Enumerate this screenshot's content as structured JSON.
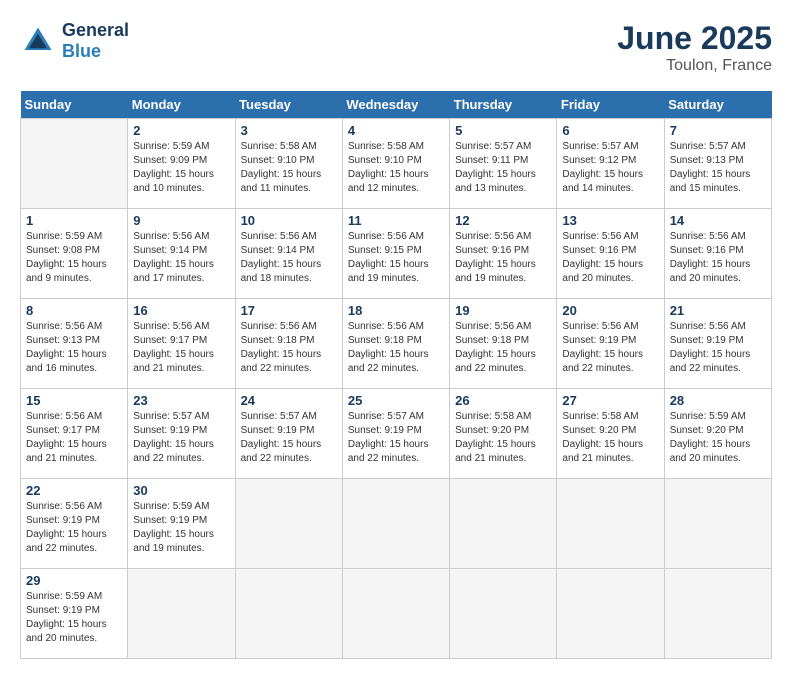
{
  "header": {
    "logo_text_general": "General",
    "logo_text_blue": "Blue",
    "month_year": "June 2025",
    "location": "Toulon, France"
  },
  "calendar": {
    "weekdays": [
      "Sunday",
      "Monday",
      "Tuesday",
      "Wednesday",
      "Thursday",
      "Friday",
      "Saturday"
    ],
    "weeks": [
      [
        null,
        {
          "day": "2",
          "sunrise": "Sunrise: 5:59 AM",
          "sunset": "Sunset: 9:09 PM",
          "daylight": "Daylight: 15 hours and 10 minutes."
        },
        {
          "day": "3",
          "sunrise": "Sunrise: 5:58 AM",
          "sunset": "Sunset: 9:10 PM",
          "daylight": "Daylight: 15 hours and 11 minutes."
        },
        {
          "day": "4",
          "sunrise": "Sunrise: 5:58 AM",
          "sunset": "Sunset: 9:10 PM",
          "daylight": "Daylight: 15 hours and 12 minutes."
        },
        {
          "day": "5",
          "sunrise": "Sunrise: 5:57 AM",
          "sunset": "Sunset: 9:11 PM",
          "daylight": "Daylight: 15 hours and 13 minutes."
        },
        {
          "day": "6",
          "sunrise": "Sunrise: 5:57 AM",
          "sunset": "Sunset: 9:12 PM",
          "daylight": "Daylight: 15 hours and 14 minutes."
        },
        {
          "day": "7",
          "sunrise": "Sunrise: 5:57 AM",
          "sunset": "Sunset: 9:13 PM",
          "daylight": "Daylight: 15 hours and 15 minutes."
        }
      ],
      [
        {
          "day": "1",
          "sunrise": "Sunrise: 5:59 AM",
          "sunset": "Sunset: 9:08 PM",
          "daylight": "Daylight: 15 hours and 9 minutes."
        },
        {
          "day": "9",
          "sunrise": "Sunrise: 5:56 AM",
          "sunset": "Sunset: 9:14 PM",
          "daylight": "Daylight: 15 hours and 17 minutes."
        },
        {
          "day": "10",
          "sunrise": "Sunrise: 5:56 AM",
          "sunset": "Sunset: 9:14 PM",
          "daylight": "Daylight: 15 hours and 18 minutes."
        },
        {
          "day": "11",
          "sunrise": "Sunrise: 5:56 AM",
          "sunset": "Sunset: 9:15 PM",
          "daylight": "Daylight: 15 hours and 19 minutes."
        },
        {
          "day": "12",
          "sunrise": "Sunrise: 5:56 AM",
          "sunset": "Sunset: 9:16 PM",
          "daylight": "Daylight: 15 hours and 19 minutes."
        },
        {
          "day": "13",
          "sunrise": "Sunrise: 5:56 AM",
          "sunset": "Sunset: 9:16 PM",
          "daylight": "Daylight: 15 hours and 20 minutes."
        },
        {
          "day": "14",
          "sunrise": "Sunrise: 5:56 AM",
          "sunset": "Sunset: 9:16 PM",
          "daylight": "Daylight: 15 hours and 20 minutes."
        }
      ],
      [
        {
          "day": "8",
          "sunrise": "Sunrise: 5:56 AM",
          "sunset": "Sunset: 9:13 PM",
          "daylight": "Daylight: 15 hours and 16 minutes."
        },
        {
          "day": "16",
          "sunrise": "Sunrise: 5:56 AM",
          "sunset": "Sunset: 9:17 PM",
          "daylight": "Daylight: 15 hours and 21 minutes."
        },
        {
          "day": "17",
          "sunrise": "Sunrise: 5:56 AM",
          "sunset": "Sunset: 9:18 PM",
          "daylight": "Daylight: 15 hours and 22 minutes."
        },
        {
          "day": "18",
          "sunrise": "Sunrise: 5:56 AM",
          "sunset": "Sunset: 9:18 PM",
          "daylight": "Daylight: 15 hours and 22 minutes."
        },
        {
          "day": "19",
          "sunrise": "Sunrise: 5:56 AM",
          "sunset": "Sunset: 9:18 PM",
          "daylight": "Daylight: 15 hours and 22 minutes."
        },
        {
          "day": "20",
          "sunrise": "Sunrise: 5:56 AM",
          "sunset": "Sunset: 9:19 PM",
          "daylight": "Daylight: 15 hours and 22 minutes."
        },
        {
          "day": "21",
          "sunrise": "Sunrise: 5:56 AM",
          "sunset": "Sunset: 9:19 PM",
          "daylight": "Daylight: 15 hours and 22 minutes."
        }
      ],
      [
        {
          "day": "15",
          "sunrise": "Sunrise: 5:56 AM",
          "sunset": "Sunset: 9:17 PM",
          "daylight": "Daylight: 15 hours and 21 minutes."
        },
        {
          "day": "23",
          "sunrise": "Sunrise: 5:57 AM",
          "sunset": "Sunset: 9:19 PM",
          "daylight": "Daylight: 15 hours and 22 minutes."
        },
        {
          "day": "24",
          "sunrise": "Sunrise: 5:57 AM",
          "sunset": "Sunset: 9:19 PM",
          "daylight": "Daylight: 15 hours and 22 minutes."
        },
        {
          "day": "25",
          "sunrise": "Sunrise: 5:57 AM",
          "sunset": "Sunset: 9:19 PM",
          "daylight": "Daylight: 15 hours and 22 minutes."
        },
        {
          "day": "26",
          "sunrise": "Sunrise: 5:58 AM",
          "sunset": "Sunset: 9:20 PM",
          "daylight": "Daylight: 15 hours and 21 minutes."
        },
        {
          "day": "27",
          "sunrise": "Sunrise: 5:58 AM",
          "sunset": "Sunset: 9:20 PM",
          "daylight": "Daylight: 15 hours and 21 minutes."
        },
        {
          "day": "28",
          "sunrise": "Sunrise: 5:59 AM",
          "sunset": "Sunset: 9:20 PM",
          "daylight": "Daylight: 15 hours and 20 minutes."
        }
      ],
      [
        {
          "day": "22",
          "sunrise": "Sunrise: 5:56 AM",
          "sunset": "Sunset: 9:19 PM",
          "daylight": "Daylight: 15 hours and 22 minutes."
        },
        {
          "day": "30",
          "sunrise": "Sunrise: 5:59 AM",
          "sunset": "Sunset: 9:19 PM",
          "daylight": "Daylight: 15 hours and 19 minutes."
        },
        null,
        null,
        null,
        null,
        null
      ],
      [
        {
          "day": "29",
          "sunrise": "Sunrise: 5:59 AM",
          "sunset": "Sunset: 9:19 PM",
          "daylight": "Daylight: 15 hours and 20 minutes."
        },
        null,
        null,
        null,
        null,
        null,
        null
      ]
    ]
  }
}
